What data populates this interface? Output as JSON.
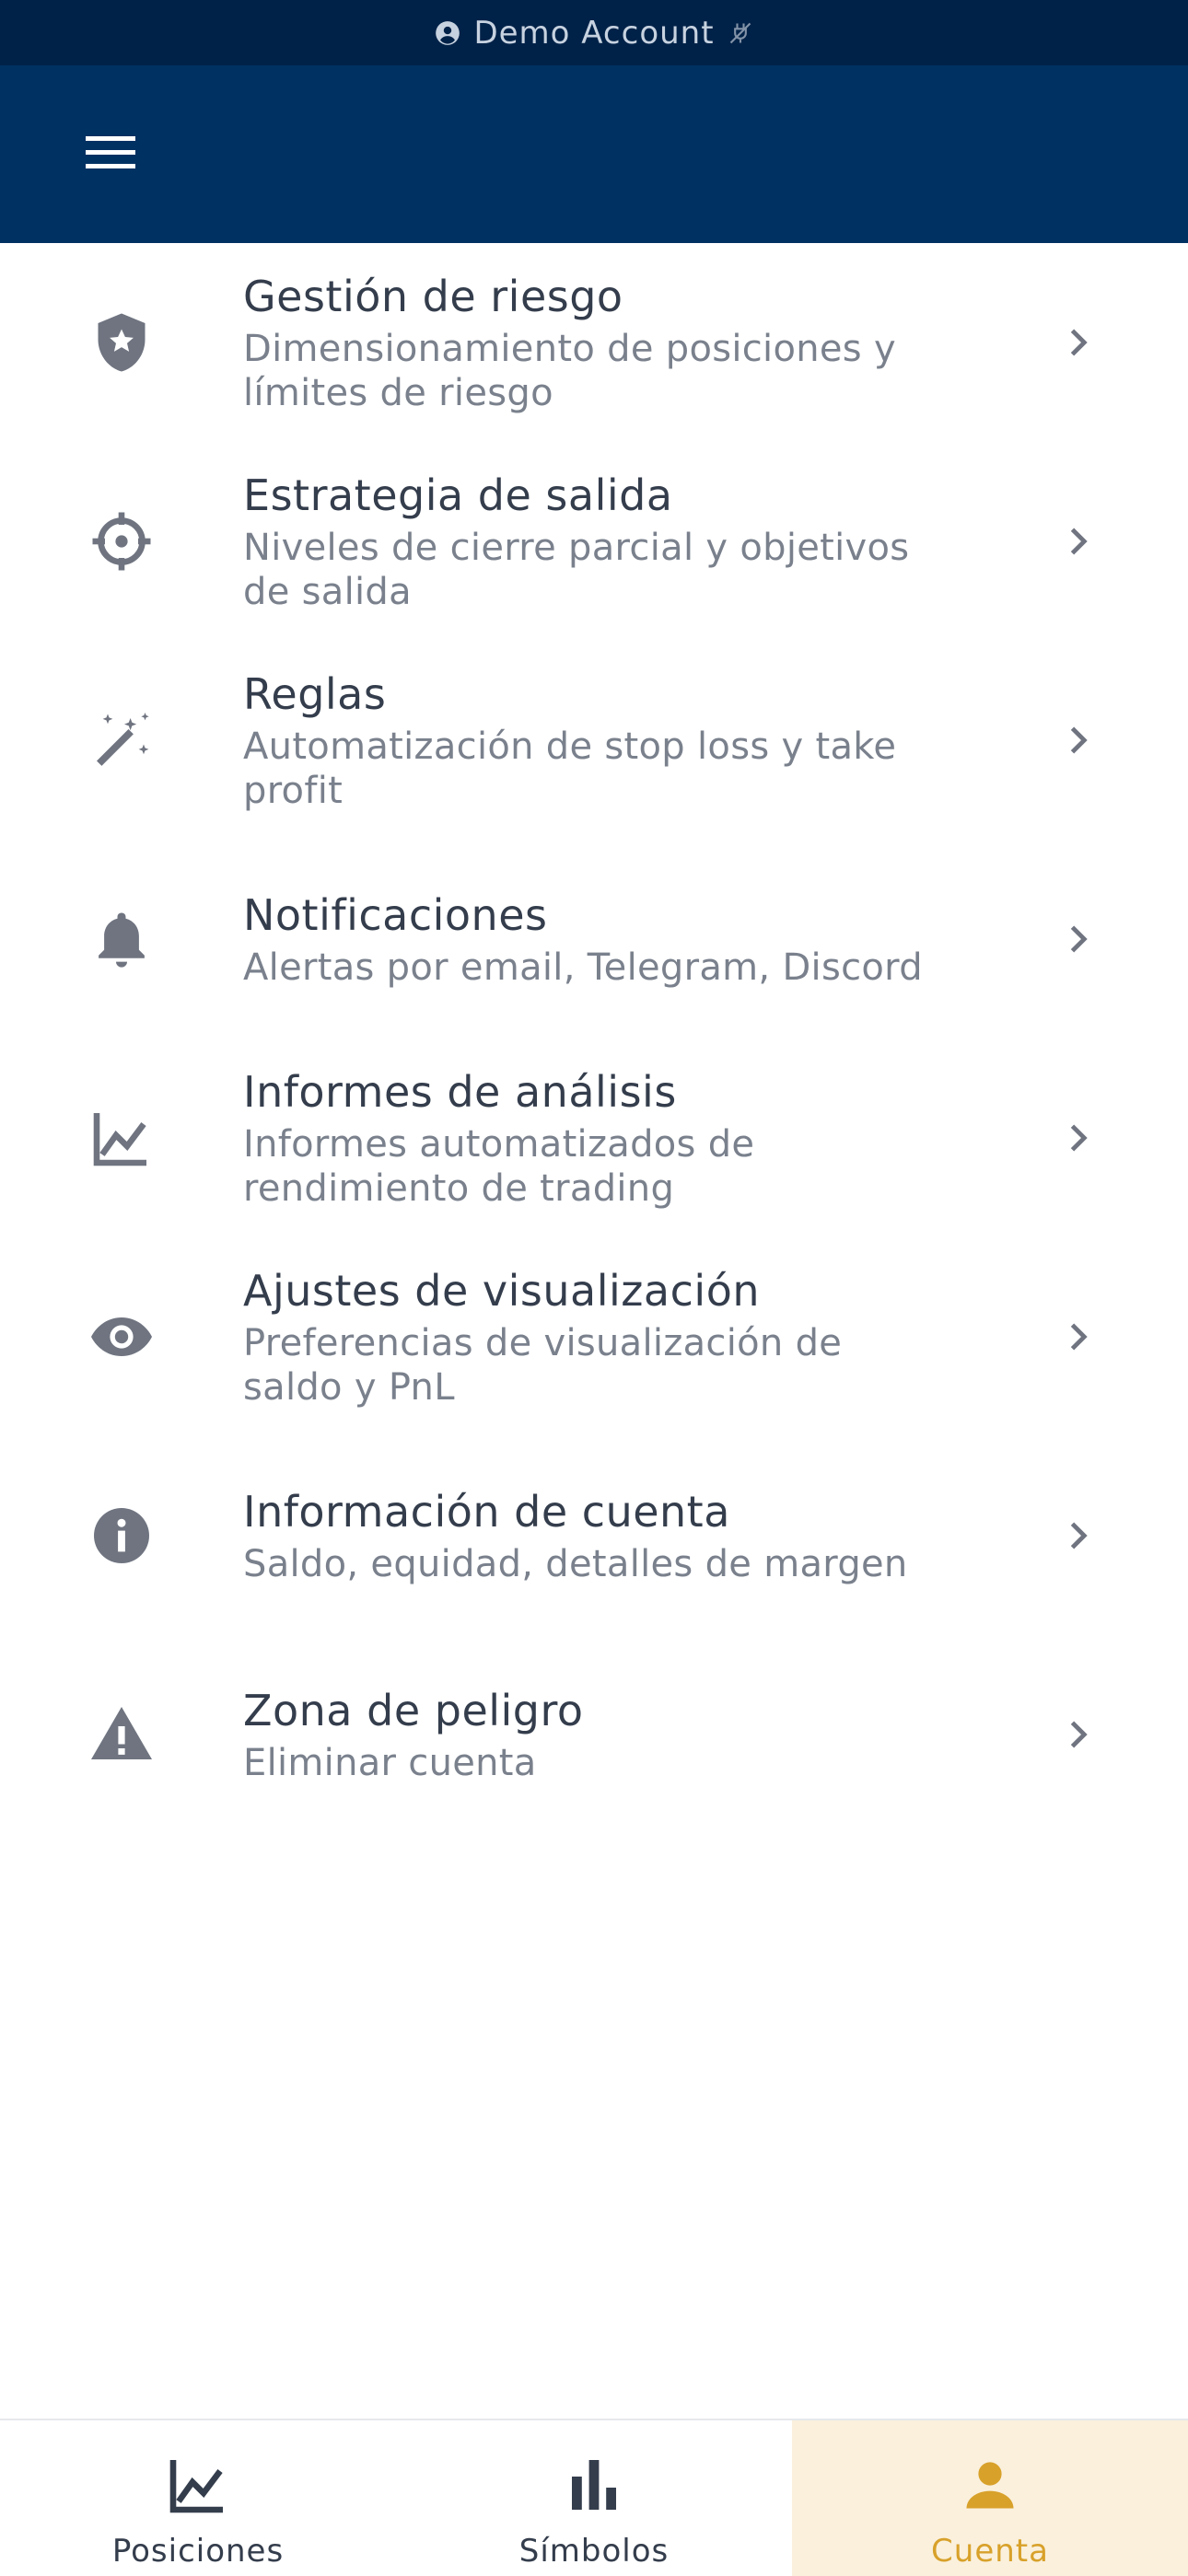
{
  "status_bar": {
    "account_label": "Demo Account",
    "account_icon": "account-circle-icon",
    "connection_icon": "disconnected-icon"
  },
  "header": {
    "menu_icon": "hamburger-menu-icon",
    "background_color": "#003163"
  },
  "settings": {
    "items": [
      {
        "title": "Gestión de riesgo",
        "subtitle": "Dimensionamiento de posiciones y límites de riesgo",
        "icon": "shield-star-icon"
      },
      {
        "title": "Estrategia de salida",
        "subtitle": "Niveles de cierre parcial y objetivos de salida",
        "icon": "crosshair-icon"
      },
      {
        "title": "Reglas",
        "subtitle": "Automatización de stop loss y take profit",
        "icon": "magic-wand-icon"
      },
      {
        "title": "Notificaciones",
        "subtitle": "Alertas por email, Telegram, Discord",
        "icon": "bell-icon"
      },
      {
        "title": "Informes de análisis",
        "subtitle": "Informes automatizados de rendimiento de trading",
        "icon": "line-chart-icon"
      },
      {
        "title": "Ajustes de visualización",
        "subtitle": "Preferencias de visualización de saldo y PnL",
        "icon": "eye-icon"
      },
      {
        "title": "Información de cuenta",
        "subtitle": "Saldo, equidad, detalles de margen",
        "icon": "info-icon"
      },
      {
        "title": "Zona de peligro",
        "subtitle": "Eliminar cuenta",
        "icon": "warning-icon"
      }
    ]
  },
  "bottom_nav": {
    "tabs": [
      {
        "label": "Posiciones",
        "icon": "line-chart-icon",
        "active": false
      },
      {
        "label": "Símbolos",
        "icon": "bar-chart-icon",
        "active": false
      },
      {
        "label": "Cuenta",
        "icon": "person-icon",
        "active": true
      }
    ],
    "active_color": "#d8a12a",
    "active_background": "#faf0dc"
  }
}
